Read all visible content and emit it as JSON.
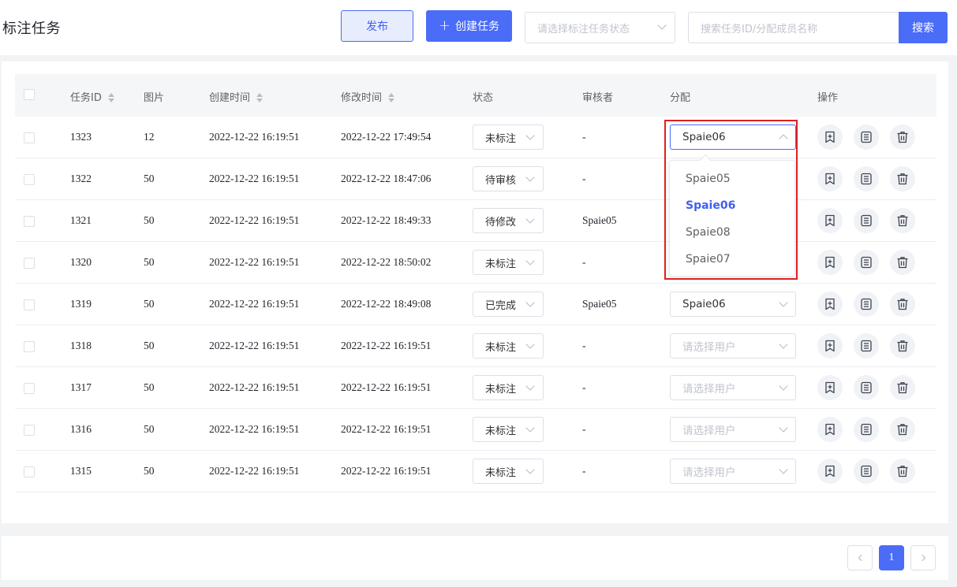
{
  "header": {
    "title": "标注任务",
    "publish_label": "发布",
    "create_label": "创建任务",
    "status_placeholder": "请选择标注任务状态",
    "search_placeholder": "搜索任务ID/分配成员名称",
    "search_label": "搜索"
  },
  "table": {
    "columns": [
      "任务ID",
      "图片",
      "创建时间",
      "修改时间",
      "状态",
      "审核者",
      "分配",
      "操作"
    ],
    "rows": [
      {
        "id": "1323",
        "images": "12",
        "created": "2022-12-22 16:19:51",
        "modified": "2022-12-22 17:49:54",
        "status": "未标注",
        "reviewer": "-",
        "assignee": "Spaie06"
      },
      {
        "id": "1322",
        "images": "50",
        "created": "2022-12-22 16:19:51",
        "modified": "2022-12-22 18:47:06",
        "status": "待审核",
        "reviewer": "-",
        "assignee": ""
      },
      {
        "id": "1321",
        "images": "50",
        "created": "2022-12-22 16:19:51",
        "modified": "2022-12-22 18:49:33",
        "status": "待修改",
        "reviewer": "Spaie05",
        "assignee": ""
      },
      {
        "id": "1320",
        "images": "50",
        "created": "2022-12-22 16:19:51",
        "modified": "2022-12-22 18:50:02",
        "status": "未标注",
        "reviewer": "-",
        "assignee": ""
      },
      {
        "id": "1319",
        "images": "50",
        "created": "2022-12-22 16:19:51",
        "modified": "2022-12-22 18:49:08",
        "status": "已完成",
        "reviewer": "Spaie05",
        "assignee": "Spaie06"
      },
      {
        "id": "1318",
        "images": "50",
        "created": "2022-12-22 16:19:51",
        "modified": "2022-12-22 16:19:51",
        "status": "未标注",
        "reviewer": "-",
        "assignee": ""
      },
      {
        "id": "1317",
        "images": "50",
        "created": "2022-12-22 16:19:51",
        "modified": "2022-12-22 16:19:51",
        "status": "未标注",
        "reviewer": "-",
        "assignee": ""
      },
      {
        "id": "1316",
        "images": "50",
        "created": "2022-12-22 16:19:51",
        "modified": "2022-12-22 16:19:51",
        "status": "未标注",
        "reviewer": "-",
        "assignee": ""
      },
      {
        "id": "1315",
        "images": "50",
        "created": "2022-12-22 16:19:51",
        "modified": "2022-12-22 16:19:51",
        "status": "未标注",
        "reviewer": "-",
        "assignee": ""
      }
    ],
    "assign_placeholder": "请选择用户"
  },
  "assign_dropdown": {
    "options": [
      "Spaie05",
      "Spaie06",
      "Spaie08",
      "Spaie07"
    ],
    "selected": "Spaie06"
  },
  "pagination": {
    "current_page": "1"
  },
  "colors": {
    "accent": "#4a6cf7",
    "highlight": "#e02020"
  },
  "icons": [
    "add-bookmark-icon",
    "document-list-icon",
    "trash-icon",
    "chevron-down-icon",
    "chevron-up-icon",
    "sort-icon",
    "chevron-left-icon",
    "chevron-right-icon"
  ]
}
